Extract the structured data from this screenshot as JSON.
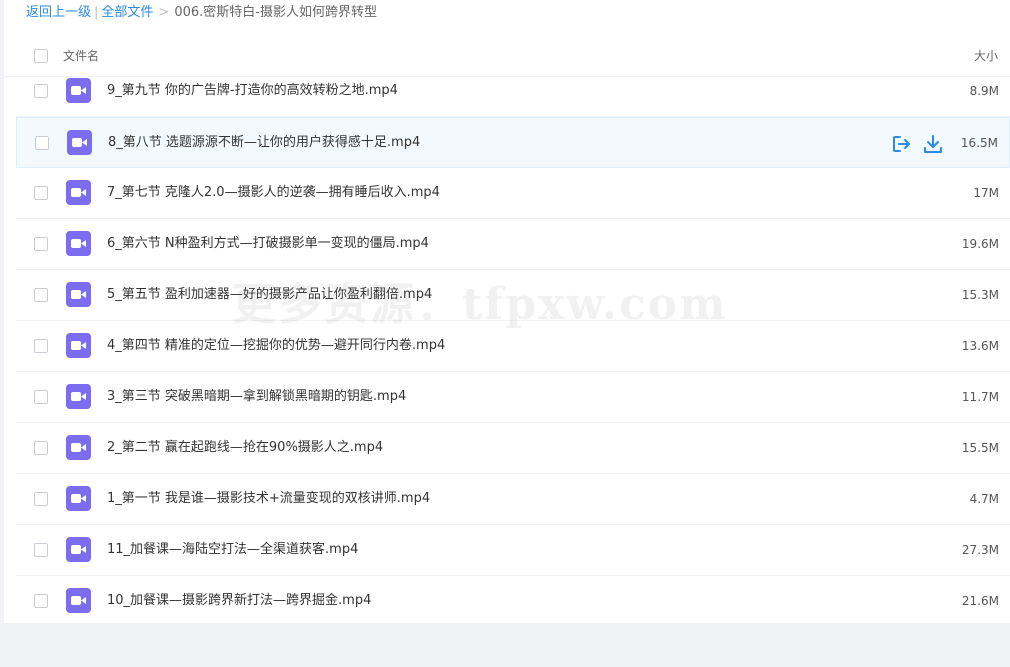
{
  "breadcrumb": {
    "back_label": "返回上一级",
    "all_files_label": "全部文件",
    "separator": ">",
    "divider": "|",
    "current": "006.密斯特白-摄影人如何跨界转型"
  },
  "header": {
    "name_col": "文件名",
    "size_col": "大小"
  },
  "files": [
    {
      "name": "9_第九节 你的广告牌-打造你的高效转粉之地.mp4",
      "size": "8.9M",
      "icon": "video-icon"
    },
    {
      "name": "8_第八节 选题源源不断—让你的用户获得感十足.mp4",
      "size": "16.5M",
      "icon": "video-icon",
      "hovered": true
    },
    {
      "name": "7_第七节 克隆人2.0—摄影人的逆袭—拥有睡后收入.mp4",
      "size": "17M",
      "icon": "video-icon"
    },
    {
      "name": "6_第六节 N种盈利方式—打破摄影单一变现的僵局.mp4",
      "size": "19.6M",
      "icon": "video-icon"
    },
    {
      "name": "5_第五节 盈利加速器—好的摄影产品让你盈利翻倍.mp4",
      "size": "15.3M",
      "icon": "video-icon"
    },
    {
      "name": "4_第四节 精准的定位—挖掘你的优势—避开同行内卷.mp4",
      "size": "13.6M",
      "icon": "video-icon"
    },
    {
      "name": "3_第三节 突破黑暗期—拿到解锁黑暗期的钥匙.mp4",
      "size": "11.7M",
      "icon": "video-icon"
    },
    {
      "name": "2_第二节 赢在起跑线—抢在90%摄影人之.mp4",
      "size": "15.5M",
      "icon": "video-icon"
    },
    {
      "name": "1_第一节 我是谁—摄影技术+流量变现的双核讲师.mp4",
      "size": "4.7M",
      "icon": "video-icon"
    },
    {
      "name": "11_加餐课—海陆空打法—全渠道获客.mp4",
      "size": "27.3M",
      "icon": "video-icon"
    },
    {
      "name": "10_加餐课—摄影跨界新打法—跨界掘金.mp4",
      "size": "21.6M",
      "icon": "video-icon"
    }
  ],
  "row_actions": {
    "share_icon": "share-icon",
    "download_icon": "download-icon"
  },
  "watermark": "更多资源：tfpxw.com",
  "colors": {
    "link": "#2a8be6",
    "video_icon_bg": "#7b6cf0",
    "hover_row_bg": "#f2f9ff",
    "action_icon": "#2a8be6"
  }
}
